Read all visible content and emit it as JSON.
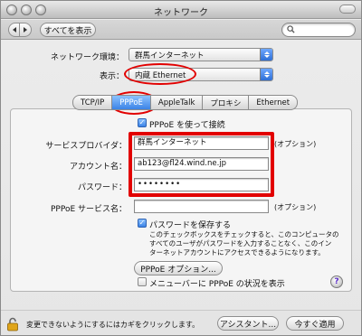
{
  "window": {
    "title": "ネットワーク"
  },
  "toolbar": {
    "show_all_label": "すべてを表示",
    "search_placeholder": ""
  },
  "network": {
    "location_label": "ネットワーク環境：",
    "location_value": "群馬インターネット",
    "show_label": "表示：",
    "show_value": "内蔵 Ethernet"
  },
  "tabs": [
    {
      "label": "TCP/IP",
      "active": false
    },
    {
      "label": "PPPoE",
      "active": true
    },
    {
      "label": "AppleTalk",
      "active": false
    },
    {
      "label": "プロキシ",
      "active": false
    },
    {
      "label": "Ethernet",
      "active": false
    }
  ],
  "pppoe": {
    "connect_checkbox_label": "PPPoE を使って接続",
    "provider_label": "サービスプロバイダ：",
    "provider_value": "群馬インターネット",
    "optional_label": "(オプション)",
    "account_label": "アカウント名：",
    "account_value": "ab123@fl24.wind.ne.jp",
    "password_label": "パスワード：",
    "password_value": "••••••••",
    "service_name_label": "PPPoE サービス名：",
    "service_name_value": "",
    "service_optional_label": "(オプション)",
    "save_password_label": "パスワードを保存する",
    "save_password_desc": [
      "このチェックボックスをチェックすると、このコンピュータの",
      "すべてのユーザがパスワードを入力することなく、このイン",
      "ターネットアカウントにアクセスできるようになります。"
    ],
    "options_button": "PPPoE オプション...",
    "menubar_checkbox_label": "メニューバーに PPPoE の状況を表示",
    "help_symbol": "?"
  },
  "bottom": {
    "lock_text": "変更できないようにするにはカギをクリックします。",
    "assist_button": "アシスタント...",
    "apply_button": "今すぐ適用"
  },
  "colors": {
    "annotation_red": "#e20000",
    "active_blue": "#3b83e6"
  }
}
